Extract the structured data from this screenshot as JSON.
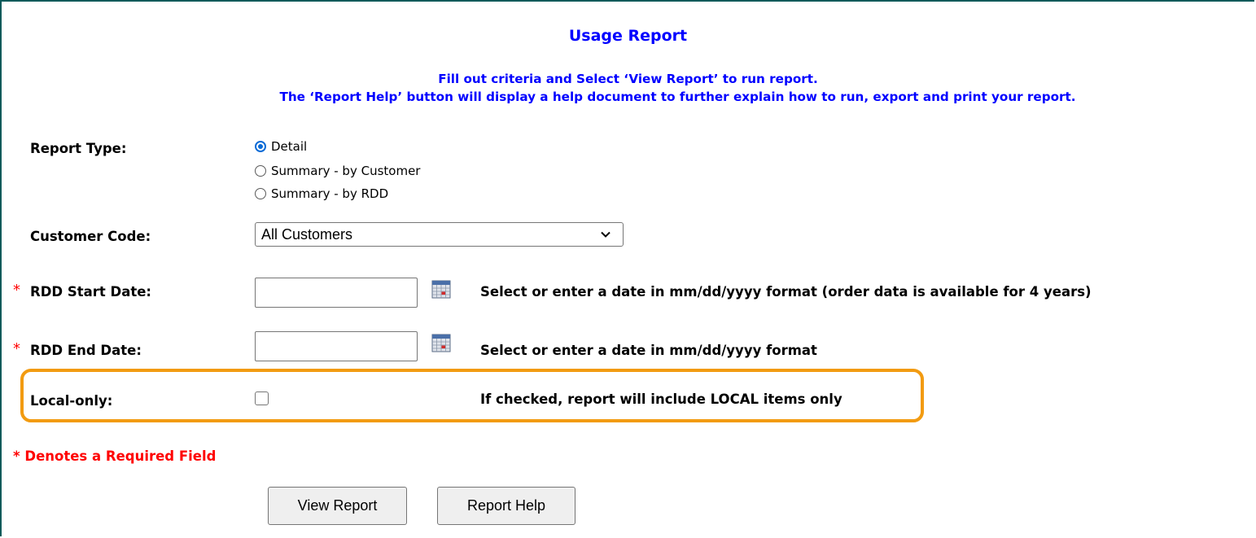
{
  "page": {
    "title": "Usage Report",
    "subtitle_line1": "Fill out criteria and Select ‘View Report’ to run report.",
    "subtitle_line2": "The ‘Report Help’ button will display a help document to further explain how to run, export and print your report."
  },
  "report_type": {
    "label": "Report Type:",
    "options": [
      "Detail",
      "Summary - by Customer",
      "Summary - by RDD"
    ],
    "selected": "Detail"
  },
  "customer_code": {
    "label": "Customer Code:",
    "selected": "All Customers"
  },
  "rdd_start": {
    "required_mark": "*",
    "label": "RDD Start Date:",
    "value": "",
    "hint": "Select or enter a date in mm/dd/yyyy format (order data is available for 4 years)"
  },
  "rdd_end": {
    "required_mark": "*",
    "label": "RDD End Date:",
    "value": "",
    "hint": "Select or enter a date in mm/dd/yyyy format"
  },
  "local_only": {
    "label": "Local-only:",
    "checked": false,
    "hint": "If checked, report will include LOCAL items only"
  },
  "required_note": "* Denotes a Required Field",
  "buttons": {
    "view_report": "View Report",
    "report_help": "Report Help"
  },
  "colors": {
    "title_blue": "#0000ff",
    "required_red": "#ff0000",
    "highlight_orange": "#f29b11",
    "radio_blue": "#0b6bd6"
  },
  "icons": {
    "calendar": "calendar-icon",
    "dropdown": "chevron-down-icon"
  }
}
